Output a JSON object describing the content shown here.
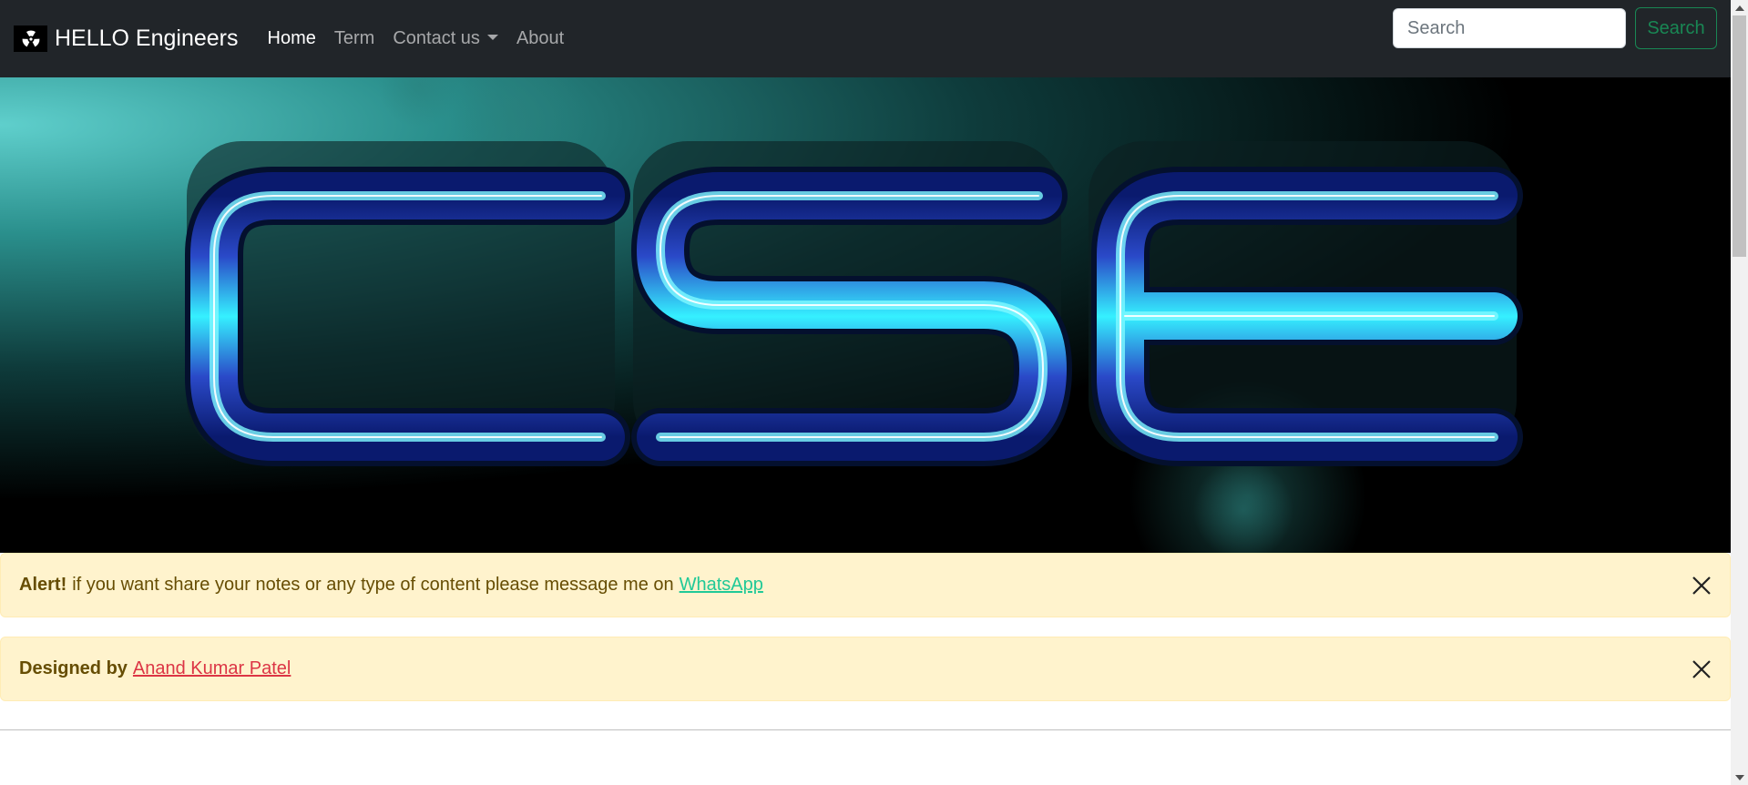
{
  "navbar": {
    "brand": "HELLO Engineers",
    "brand_icon": "radiation-icon",
    "links": [
      {
        "label": "Home",
        "active": true
      },
      {
        "label": "Term",
        "active": false
      },
      {
        "label": "Contact us",
        "active": false,
        "dropdown": true
      },
      {
        "label": "About",
        "active": false
      }
    ],
    "search": {
      "placeholder": "Search",
      "value": "",
      "button_label": "Search"
    }
  },
  "hero": {
    "banner_text": "CSE"
  },
  "alerts": [
    {
      "strong": "Alert!",
      "text": "if you want share your notes or any type of content please message me on",
      "link": "WhatsApp",
      "link_color": "#20c997"
    },
    {
      "strong": "Designed by",
      "text": "",
      "link": "Anand Kumar Patel",
      "link_color": "#dc3545"
    }
  ],
  "colors": {
    "navbar_bg": "#212529",
    "alert_bg": "#fff3cd",
    "search_btn": "#198754"
  }
}
